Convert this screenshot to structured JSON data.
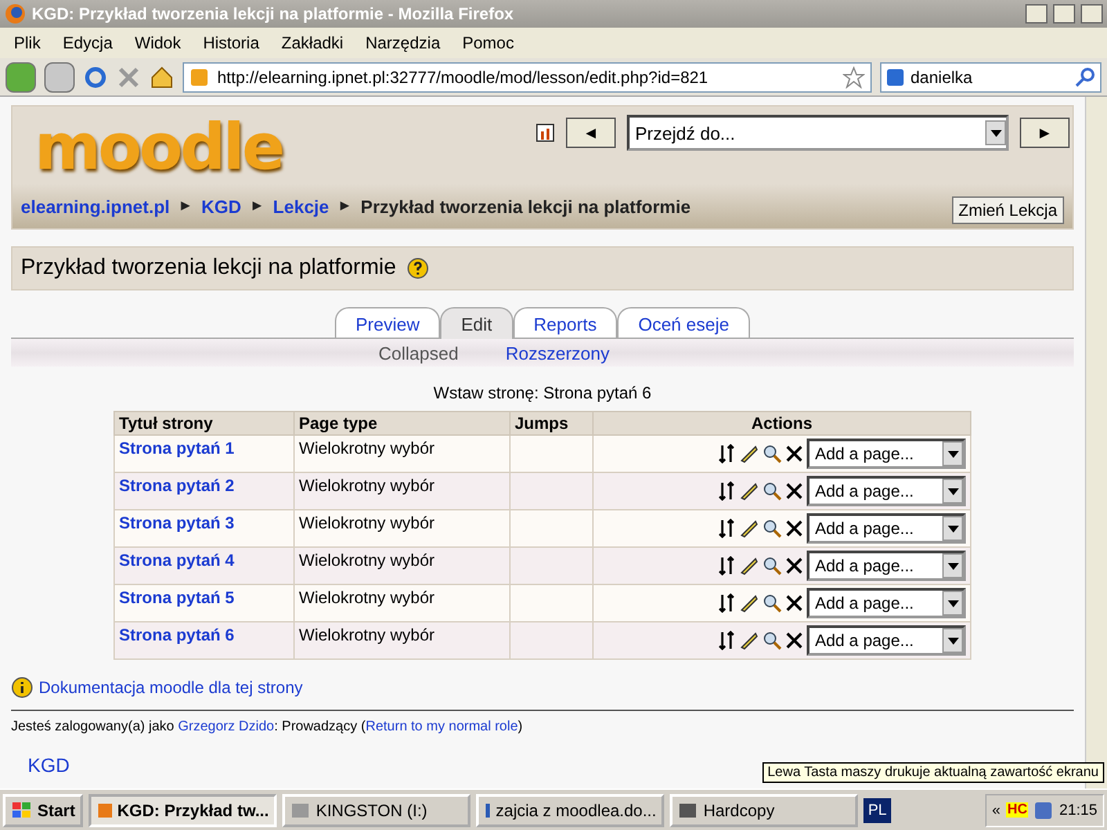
{
  "browser": {
    "title": "KGD: Przykład tworzenia lekcji na platformie - Mozilla Firefox",
    "menu": [
      "Plik",
      "Edycja",
      "Widok",
      "Historia",
      "Zakładki",
      "Narzędzia",
      "Pomoc"
    ],
    "url": "http://elearning.ipnet.pl:32777/moodle/mod/lesson/edit.php?id=821",
    "search": "danielka"
  },
  "page": {
    "logo": "moodle",
    "jump_placeholder": "Przejdź do...",
    "jump_prev": "◄",
    "jump_next": "►",
    "breadcrumb": [
      {
        "label": "elearning.ipnet.pl",
        "link": true
      },
      {
        "label": "KGD",
        "link": true
      },
      {
        "label": "Lekcje",
        "link": true
      },
      {
        "label": "Przykład tworzenia lekcji na platformie",
        "link": false
      }
    ],
    "separator": "►",
    "change_button": "Zmień Lekcja",
    "heading": "Przykład tworzenia lekcji na platformie",
    "tabs": [
      {
        "label": "Preview",
        "selected": false
      },
      {
        "label": "Edit",
        "selected": true
      },
      {
        "label": "Reports",
        "selected": false
      },
      {
        "label": "Oceń eseje",
        "selected": false
      }
    ],
    "subtabs": [
      {
        "label": "Collapsed",
        "selected": true
      },
      {
        "label": "Rozszerzony",
        "selected": false
      }
    ],
    "insert_label": "Wstaw stronę: Strona pytań 6",
    "columns": [
      "Tytuł strony",
      "Page type",
      "Jumps",
      "Actions"
    ],
    "rows": [
      {
        "title": "Strona pytań 1",
        "type": "Wielokrotny wybór",
        "action": "Add a page..."
      },
      {
        "title": "Strona pytań 2",
        "type": "Wielokrotny wybór",
        "action": "Add a page..."
      },
      {
        "title": "Strona pytań 3",
        "type": "Wielokrotny wybór",
        "action": "Add a page..."
      },
      {
        "title": "Strona pytań 4",
        "type": "Wielokrotny wybór",
        "action": "Add a page..."
      },
      {
        "title": "Strona pytań 5",
        "type": "Wielokrotny wybór",
        "action": "Add a page..."
      },
      {
        "title": "Strona pytań 6",
        "type": "Wielokrotny wybór",
        "action": "Add a page..."
      }
    ],
    "doc_link": "Dokumentacja moodle dla tej strony",
    "login": {
      "prefix": "Jesteś zalogowany(a) jako ",
      "user": "Grzegorz Dzido",
      "middle": ": Prowadzący (",
      "return_link": "Return to my normal role",
      "suffix": ")"
    },
    "footer_link": "KGD"
  },
  "taskbar": {
    "start": "Start",
    "tasks": [
      {
        "label": "KGD: Przykład tw...",
        "selected": true
      },
      {
        "label": "KINGSTON (I:)",
        "selected": false
      },
      {
        "label": "zajcia z moodlea.do...",
        "selected": false
      },
      {
        "label": "Hardcopy",
        "selected": false
      }
    ],
    "lang": "PL",
    "tray_text": "«",
    "tray_badge": "HC",
    "time": "21:15",
    "tooltip": "Lewa Tasta maszy drukuje aktualną zawartość ekranu"
  }
}
